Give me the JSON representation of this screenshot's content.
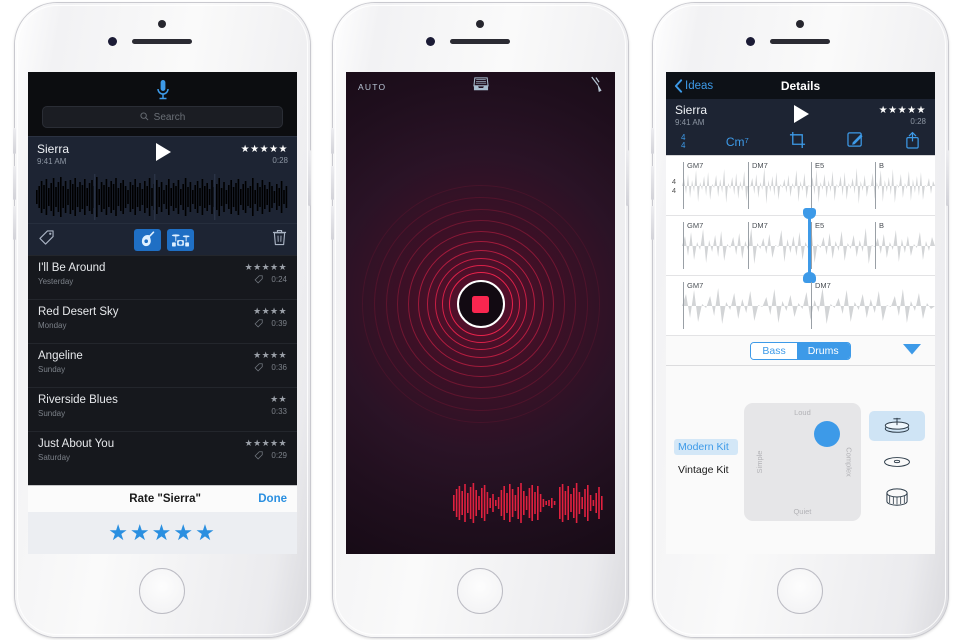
{
  "phone1": {
    "name": "ideas-list-screen",
    "search": {
      "placeholder": "Search",
      "icon": "search-icon"
    },
    "mic_icon": "microphone-icon",
    "selected": {
      "title": "Sierra",
      "time": "9:41 AM",
      "stars": "★★★★★",
      "duration": "0:28",
      "play_icon": "play-icon",
      "tools": {
        "tag": "tag-icon",
        "guitar": "guitar-icon",
        "drums": "drum-kit-icon",
        "trash": "trash-icon"
      }
    },
    "rows": [
      {
        "name": "I'll Be Around",
        "date": "Yesterday",
        "stars": "★★★★★",
        "duration": "0:24",
        "has_tag": true
      },
      {
        "name": "Red Desert Sky",
        "date": "Monday",
        "stars": "★★★★",
        "duration": "0:39",
        "has_tag": true
      },
      {
        "name": "Angeline",
        "date": "Sunday",
        "stars": "★★★★",
        "duration": "0:36",
        "has_tag": true
      },
      {
        "name": "Riverside Blues",
        "date": "Sunday",
        "stars": "★★",
        "duration": "0:33",
        "has_tag": false
      },
      {
        "name": "Just About You",
        "date": "Saturday",
        "stars": "★★★★★",
        "duration": "0:29",
        "has_tag": true
      }
    ],
    "rate_bar": {
      "title": "Rate \"Sierra\"",
      "done_label": "Done",
      "stars": "★★★★★"
    }
  },
  "phone2": {
    "name": "recording-screen",
    "auto_label": "AUTO",
    "inbox_icon": "inbox-icon",
    "tuning_fork_icon": "tuning-fork-icon",
    "record_button": {
      "icon": "stop-square-icon",
      "state": "recording"
    },
    "accent_color": "#f9264f",
    "background_color": "#2a1326"
  },
  "phone3": {
    "name": "details-screen",
    "nav": {
      "back_label": "Ideas",
      "back_icon": "chevron-left-icon",
      "title": "Details"
    },
    "header": {
      "title": "Sierra",
      "time": "9:41 AM",
      "stars": "★★★★★",
      "duration": "0:28",
      "play_icon": "play-icon"
    },
    "toolbar": {
      "time_signature_top": "4",
      "time_signature_bottom": "4",
      "key_label": "Cm⁷",
      "crop_icon": "crop-icon",
      "edit_icon": "edit-icon",
      "share_icon": "share-icon"
    },
    "tracks": [
      {
        "time_sig_top": "4",
        "time_sig_bottom": "4",
        "chords": [
          "GM7",
          "DM7",
          "E5",
          "B"
        ]
      },
      {
        "time_sig_top": "",
        "time_sig_bottom": "",
        "chords": [
          "GM7",
          "DM7",
          "E5",
          "B"
        ],
        "trim_selected": true
      },
      {
        "time_sig_top": "",
        "time_sig_bottom": "",
        "chords": [
          "GM7",
          "DM7"
        ]
      }
    ],
    "segmented": {
      "options": [
        "Bass",
        "Drums"
      ],
      "selected": "Drums",
      "caret_icon": "chevron-down-icon"
    },
    "kits": {
      "options": [
        "Modern Kit",
        "Vintage Kit"
      ],
      "selected": "Modern Kit"
    },
    "xy_pad": {
      "top_label": "Loud",
      "bottom_label": "Quiet",
      "left_label": "Simple",
      "right_label": "Complex"
    },
    "kit_icons": [
      {
        "name": "hi-hat-icon",
        "selected": true
      },
      {
        "name": "cymbal-icon",
        "selected": false
      },
      {
        "name": "snare-drum-icon",
        "selected": false
      }
    ],
    "accent_color": "#3d9ae8"
  }
}
